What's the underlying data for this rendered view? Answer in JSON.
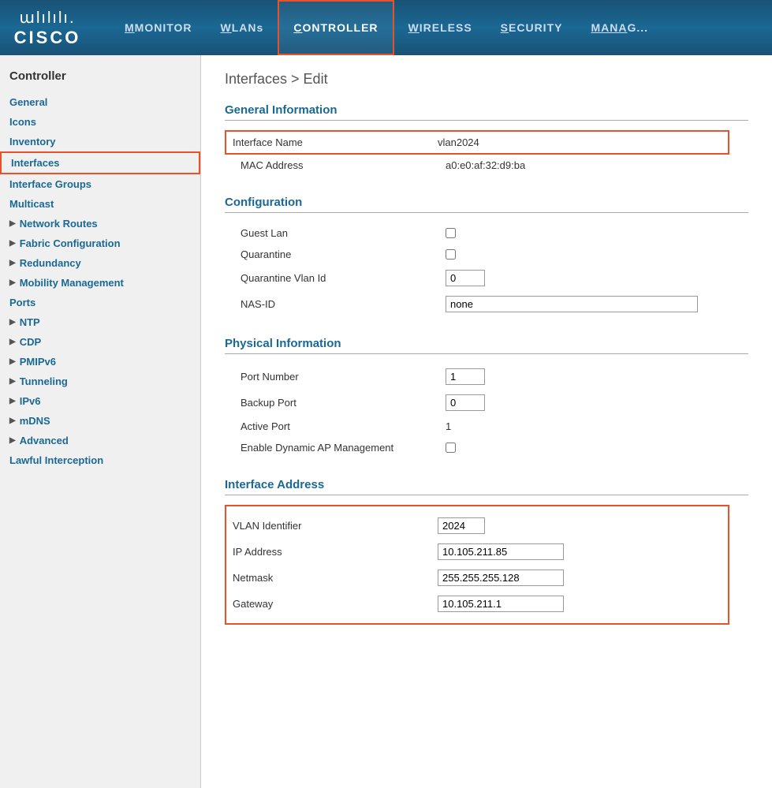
{
  "logo": {
    "icon": "աlılılı.",
    "text": "CISCO"
  },
  "nav": {
    "items": [
      {
        "label": "MONITOR",
        "underline_start": 0,
        "active": false
      },
      {
        "label": "WLANs",
        "underline_start": 0,
        "active": false
      },
      {
        "label": "CONTROLLER",
        "underline_start": 0,
        "active": true
      },
      {
        "label": "WIRELESS",
        "underline_start": 0,
        "active": false
      },
      {
        "label": "SECURITY",
        "underline_start": 0,
        "active": false
      },
      {
        "label": "MANAG...",
        "underline_start": 0,
        "active": false
      }
    ]
  },
  "sidebar": {
    "title": "Controller",
    "items": [
      {
        "id": "general",
        "label": "General",
        "has_arrow": false,
        "active": false
      },
      {
        "id": "icons",
        "label": "Icons",
        "has_arrow": false,
        "active": false
      },
      {
        "id": "inventory",
        "label": "Inventory",
        "has_arrow": false,
        "active": false
      },
      {
        "id": "interfaces",
        "label": "Interfaces",
        "has_arrow": false,
        "active": true
      },
      {
        "id": "interface-groups",
        "label": "Interface Groups",
        "has_arrow": false,
        "active": false
      },
      {
        "id": "multicast",
        "label": "Multicast",
        "has_arrow": false,
        "active": false
      },
      {
        "id": "network-routes",
        "label": "Network Routes",
        "has_arrow": true,
        "active": false
      },
      {
        "id": "fabric-configuration",
        "label": "Fabric Configuration",
        "has_arrow": true,
        "active": false
      },
      {
        "id": "redundancy",
        "label": "Redundancy",
        "has_arrow": true,
        "active": false
      },
      {
        "id": "mobility-management",
        "label": "Mobility Management",
        "has_arrow": true,
        "active": false
      },
      {
        "id": "ports",
        "label": "Ports",
        "has_arrow": false,
        "active": false
      },
      {
        "id": "ntp",
        "label": "NTP",
        "has_arrow": true,
        "active": false
      },
      {
        "id": "cdp",
        "label": "CDP",
        "has_arrow": true,
        "active": false
      },
      {
        "id": "pmipv6",
        "label": "PMIPv6",
        "has_arrow": true,
        "active": false
      },
      {
        "id": "tunneling",
        "label": "Tunneling",
        "has_arrow": true,
        "active": false
      },
      {
        "id": "ipv6",
        "label": "IPv6",
        "has_arrow": true,
        "active": false
      },
      {
        "id": "mdns",
        "label": "mDNS",
        "has_arrow": true,
        "active": false
      },
      {
        "id": "advanced",
        "label": "Advanced",
        "has_arrow": true,
        "active": false
      },
      {
        "id": "lawful-interception",
        "label": "Lawful Interception",
        "has_arrow": false,
        "active": false
      }
    ]
  },
  "page": {
    "title": "Interfaces > Edit",
    "sections": {
      "general_information": {
        "title": "General Information",
        "interface_name_label": "Interface Name",
        "interface_name_value": "vlan2024",
        "mac_address_label": "MAC Address",
        "mac_address_value": "a0:e0:af:32:d9:ba"
      },
      "configuration": {
        "title": "Configuration",
        "guest_lan_label": "Guest Lan",
        "quarantine_label": "Quarantine",
        "quarantine_vlan_id_label": "Quarantine Vlan Id",
        "quarantine_vlan_id_value": "0",
        "nas_id_label": "NAS-ID",
        "nas_id_value": "none"
      },
      "physical_information": {
        "title": "Physical Information",
        "port_number_label": "Port Number",
        "port_number_value": "1",
        "backup_port_label": "Backup Port",
        "backup_port_value": "0",
        "active_port_label": "Active Port",
        "active_port_value": "1",
        "enable_dynamic_ap_label": "Enable Dynamic AP Management"
      },
      "interface_address": {
        "title": "Interface Address",
        "vlan_id_label": "VLAN Identifier",
        "vlan_id_value": "2024",
        "ip_address_label": "IP Address",
        "ip_address_value": "10.105.211.85",
        "netmask_label": "Netmask",
        "netmask_value": "255.255.255.128",
        "gateway_label": "Gateway",
        "gateway_value": "10.105.211.1"
      }
    }
  }
}
